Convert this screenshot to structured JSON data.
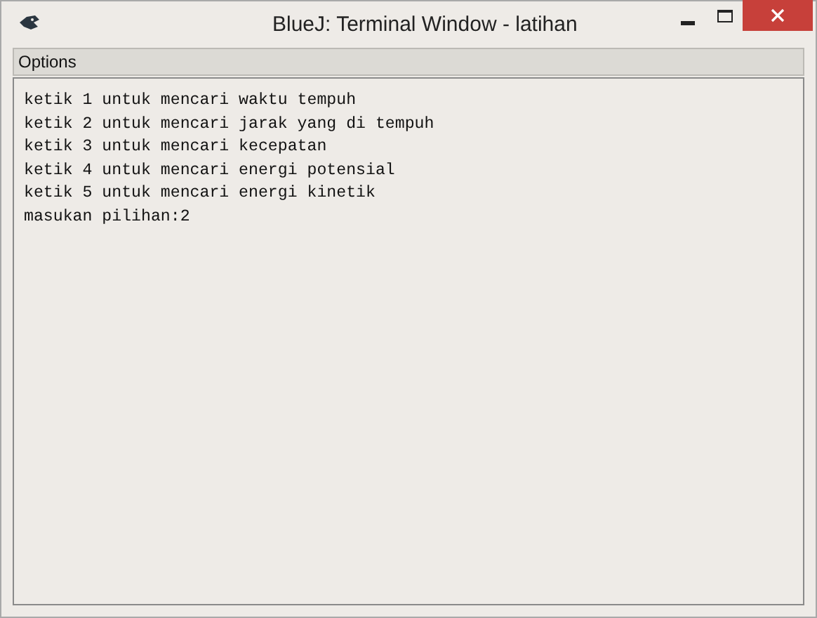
{
  "window": {
    "title": "BlueJ: Terminal Window - latihan"
  },
  "menu": [
    "Options"
  ],
  "terminal": {
    "lines": [
      "ketik 1 untuk mencari waktu tempuh",
      "ketik 2 untuk mencari jarak yang di tempuh",
      "ketik 3 untuk mencari kecepatan",
      "ketik 4 untuk mencari energi potensial",
      "ketik 5 untuk mencari energi kinetik",
      "masukan pilihan:2"
    ]
  }
}
